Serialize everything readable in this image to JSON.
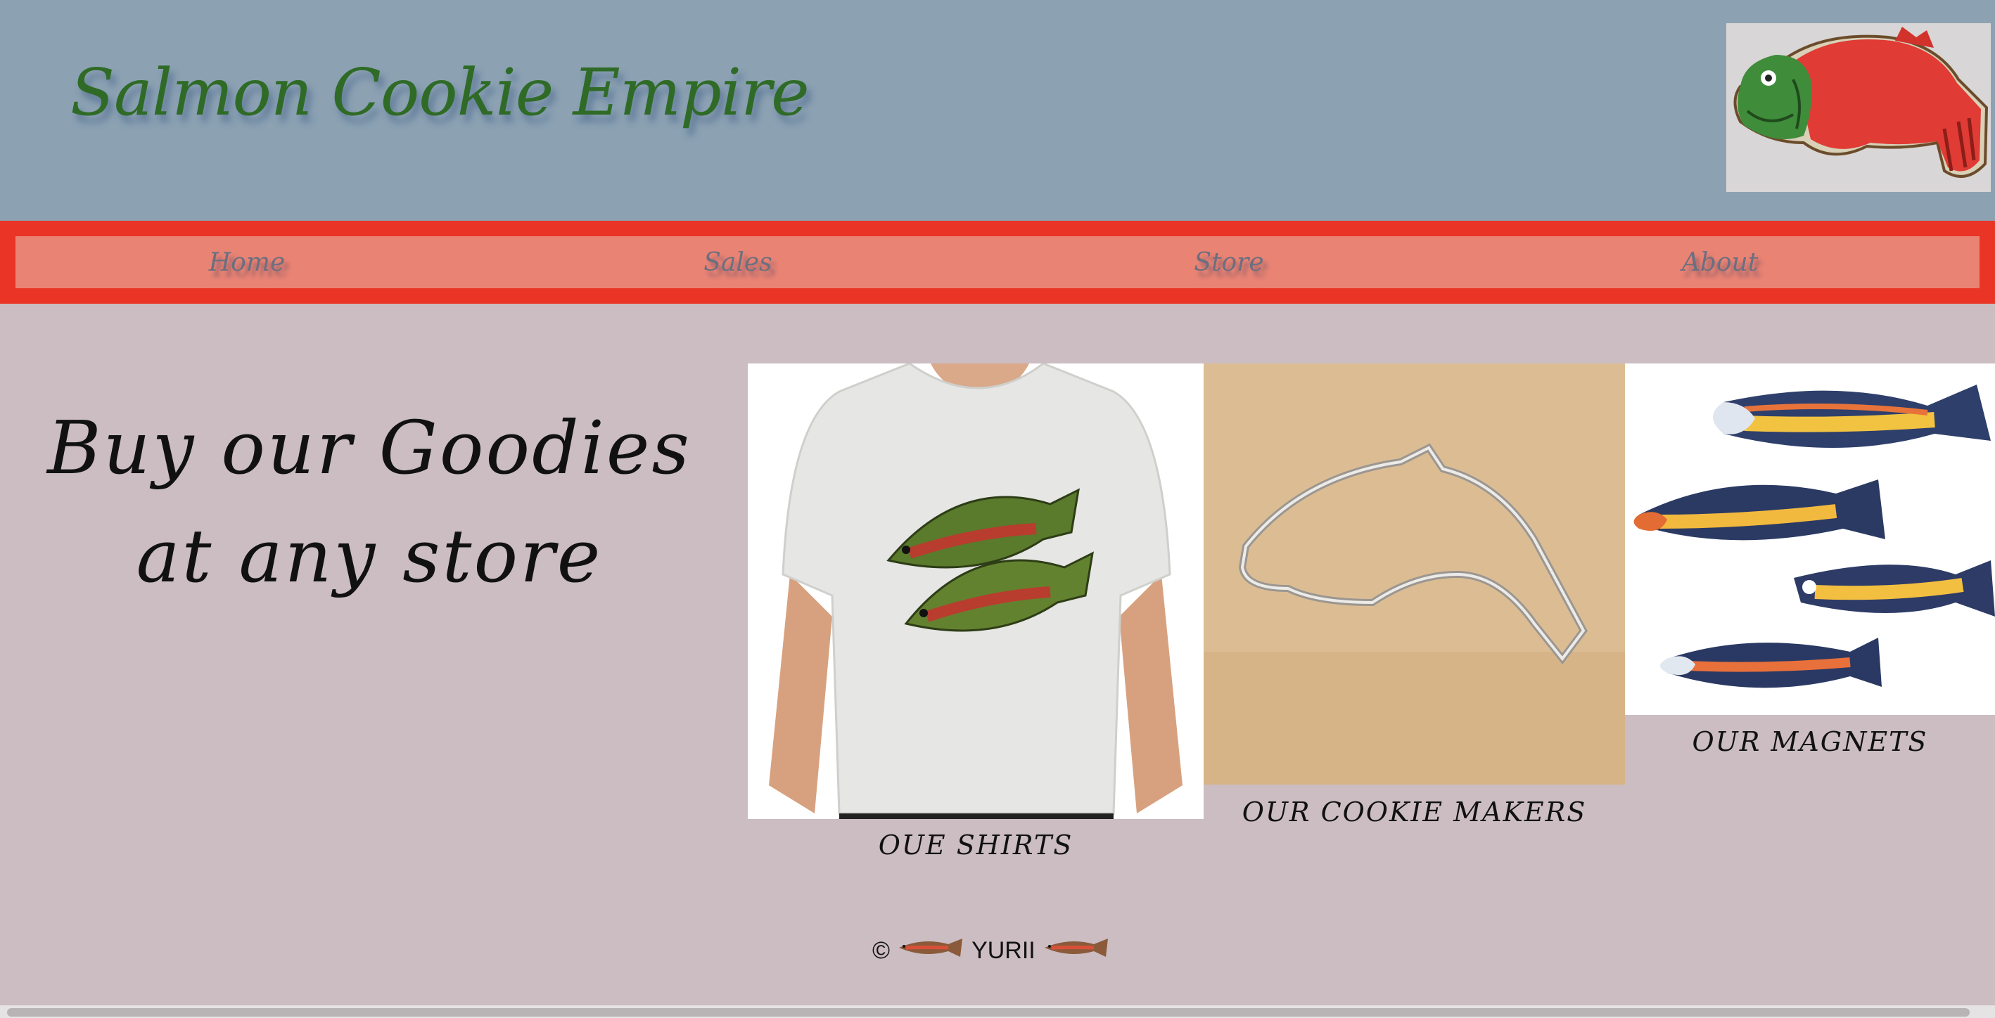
{
  "header": {
    "title": "Salmon Cookie Empire",
    "logo_icon": "salmon-cookie-icon"
  },
  "nav": {
    "items": [
      {
        "label": "Home"
      },
      {
        "label": "Sales"
      },
      {
        "label": "Store"
      },
      {
        "label": "About"
      }
    ]
  },
  "main": {
    "promo_line1": "Buy our Goodies",
    "promo_line2": "at any store",
    "products": [
      {
        "caption": "OUE SHIRTS",
        "image": "salmon-tshirt-image"
      },
      {
        "caption": "OUR COOKIE MAKERS",
        "image": "salmon-cookie-cutter-image"
      },
      {
        "caption": "OUR MAGNETS",
        "image": "salmon-magnets-image"
      }
    ]
  },
  "footer": {
    "copyright_symbol": "©",
    "name": "YURII"
  },
  "colors": {
    "header_bg": "#8ca2b3",
    "title": "#2f6b26",
    "nav_border": "#ea3526",
    "nav_bg": "#e98374",
    "page_bg": "#cbbdc1"
  }
}
